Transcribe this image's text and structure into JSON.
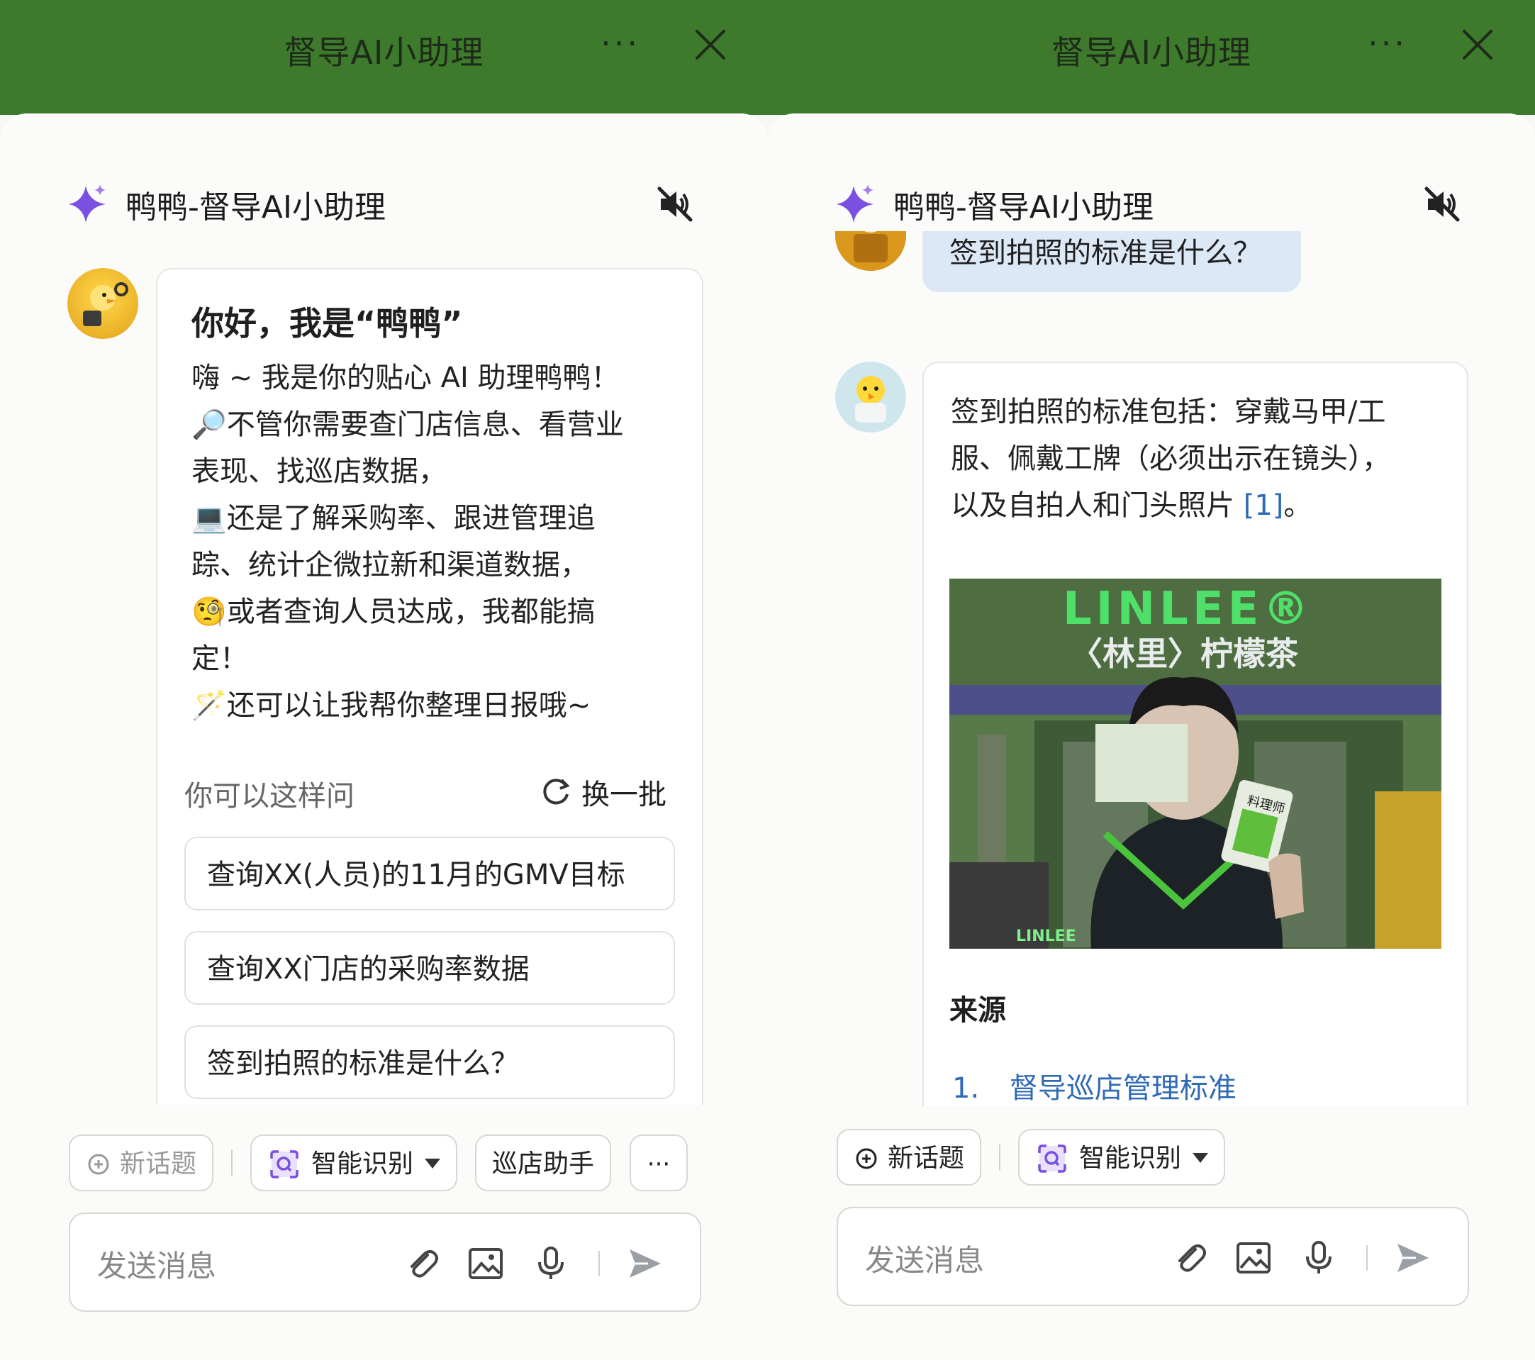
{
  "left": {
    "topbar": {
      "title": "督导AI小助理",
      "more": "···"
    },
    "header": {
      "name": "鸭鸭-督导AI小助理"
    },
    "welcome": {
      "title": "你好，我是“鸭鸭”",
      "lines": [
        "嗨 ~ 我是你的贴心 AI 助理鸭鸭！",
        "🔎不管你需要查门店信息、看营业",
        "表现、找巡店数据，",
        "💻还是了解采购率、跟进管理追",
        "踪、统计企微拉新和渠道数据，",
        "🧐或者查询人员达成，我都能搞",
        "定！",
        "🪄还可以让我帮你整理日报哦~"
      ],
      "ask_label": "你可以这样问",
      "refresh_label": "换一批",
      "suggestions": [
        "查询XX(人员)的11月的GMV目标",
        "查询XX门店的采购率数据",
        "签到拍照的标准是什么？"
      ]
    },
    "toolbar": {
      "new_topic": "新话题",
      "smart": "智能识别",
      "shop": "巡店助手",
      "more": "···"
    },
    "input": {
      "placeholder": "发送消息"
    }
  },
  "right": {
    "topbar": {
      "title": "督导AI小助理",
      "more": "···"
    },
    "header": {
      "name": "鸭鸭-督导AI小助理"
    },
    "user_message": "签到拍照的标准是什么？",
    "answer": {
      "lines": [
        "签到拍照的标准包括：穿戴马甲/工",
        "服、佩戴工牌（必须出示在镜头），",
        "以及自拍人和门头照片"
      ],
      "cite": "[1]",
      "end": "。",
      "photo": {
        "sign_logo": "LINLEE®",
        "sign_sub": "〈林里〉柠檬茶",
        "badge": "料理师",
        "shirt": "LINLEE"
      },
      "sources_title": "来源",
      "source_index": "1.",
      "source_link": "督导巡店管理标准"
    },
    "toolbar": {
      "new_topic": "新话题",
      "smart": "智能识别"
    },
    "input": {
      "placeholder": "发送消息"
    }
  },
  "colors": {
    "topbar": "#3d7a2c",
    "accent_purple": "#7b4fe0",
    "link": "#2f6ab5",
    "user_bubble": "#dde8f7"
  }
}
